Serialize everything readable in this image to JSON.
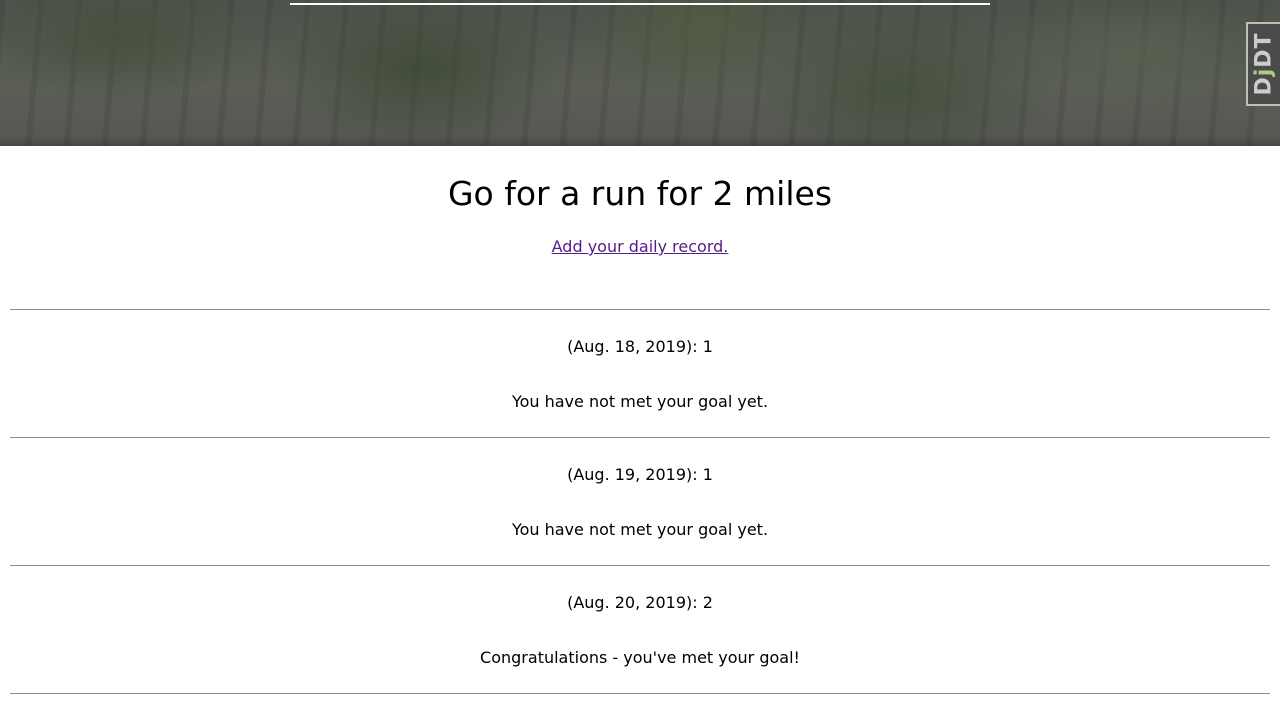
{
  "hero": {
    "toolbar_handle": {
      "prefix": "D",
      "mark": "j",
      "suffix": "DT"
    }
  },
  "goal": {
    "title": "Go for a run for 2 miles",
    "add_record_link": "Add your daily record."
  },
  "records": [
    {
      "date_text": "(Aug. 18, 2019): 1",
      "status": "You have not met your goal yet."
    },
    {
      "date_text": "(Aug. 19, 2019): 1",
      "status": "You have not met your goal yet."
    },
    {
      "date_text": "(Aug. 20, 2019): 2",
      "status": "Congratulations - you've met your goal!"
    }
  ],
  "colors": {
    "link": "#551a8b",
    "divider": "#8a8a8a"
  }
}
